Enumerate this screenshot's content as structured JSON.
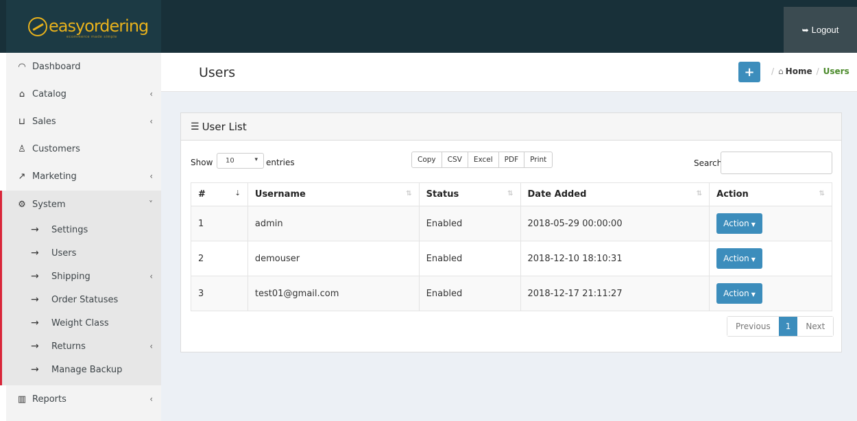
{
  "brand": {
    "name": "easyordering",
    "tagline": "ecommerce made simple"
  },
  "topbar": {
    "logout_label": "Logout"
  },
  "sidebar": {
    "items": [
      {
        "label": "Dashboard",
        "icon": "dashboard-icon",
        "has_children": false
      },
      {
        "label": "Catalog",
        "icon": "tag-icon",
        "has_children": true
      },
      {
        "label": "Sales",
        "icon": "cart-icon",
        "has_children": true
      },
      {
        "label": "Customers",
        "icon": "user-icon",
        "has_children": false
      },
      {
        "label": "Marketing",
        "icon": "share-icon",
        "has_children": true
      },
      {
        "label": "System",
        "icon": "gear-icon",
        "has_children": true,
        "expanded": true
      },
      {
        "label": "Reports",
        "icon": "bar-chart-icon",
        "has_children": true
      }
    ],
    "system_children": [
      {
        "label": "Settings",
        "has_children": false
      },
      {
        "label": "Users",
        "has_children": false
      },
      {
        "label": "Shipping",
        "has_children": true
      },
      {
        "label": "Order Statuses",
        "has_children": false
      },
      {
        "label": "Weight Class",
        "has_children": false
      },
      {
        "label": "Returns",
        "has_children": true
      },
      {
        "label": "Manage Backup",
        "has_children": false
      }
    ]
  },
  "page": {
    "title": "Users",
    "add_button": "+",
    "breadcrumb": {
      "home": "Home",
      "current": "Users",
      "separator": "/"
    }
  },
  "box": {
    "title": "User List",
    "controls": {
      "show_label": "Show",
      "entries_value": "10",
      "entries_label": "entries",
      "export_buttons": [
        "Copy",
        "CSV",
        "Excel",
        "PDF",
        "Print"
      ],
      "search_label": "Search:",
      "search_value": ""
    },
    "table": {
      "columns": [
        "#",
        "Username",
        "Status",
        "Date Added",
        "Action"
      ],
      "rows": [
        {
          "num": "1",
          "username": "admin",
          "status": "Enabled",
          "date_added": "2018-05-29 00:00:00",
          "action": "Action"
        },
        {
          "num": "2",
          "username": "demouser",
          "status": "Enabled",
          "date_added": "2018-12-10 18:10:31",
          "action": "Action"
        },
        {
          "num": "3",
          "username": "test01@gmail.com",
          "status": "Enabled",
          "date_added": "2018-12-17 21:11:27",
          "action": "Action"
        }
      ]
    },
    "pagination": {
      "previous": "Previous",
      "current_page": "1",
      "next": "Next"
    }
  },
  "colors": {
    "topbar": "#183039",
    "brand": "#e9b21c",
    "primary": "#3c8dbc",
    "active_marker": "#d9263a",
    "breadcrumb_current": "#4a8a2a"
  }
}
